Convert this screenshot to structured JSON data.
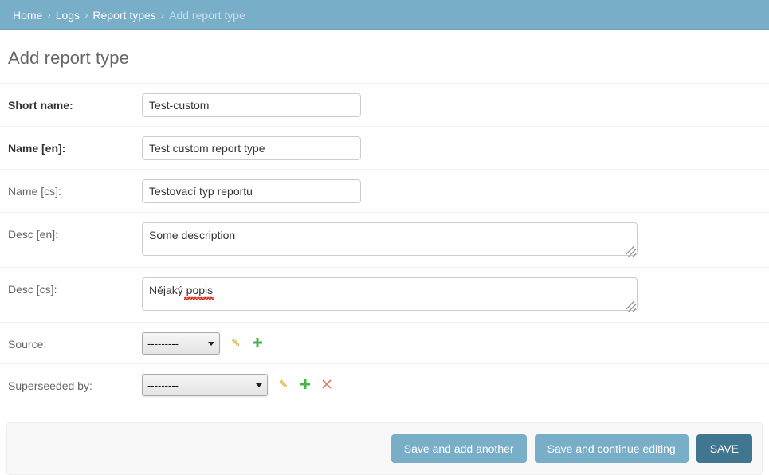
{
  "breadcrumbs": {
    "separator": "›",
    "items": [
      {
        "label": "Home",
        "current": false
      },
      {
        "label": "Logs",
        "current": false
      },
      {
        "label": "Report types",
        "current": false
      },
      {
        "label": "Add report type",
        "current": true
      }
    ]
  },
  "page": {
    "title": "Add report type"
  },
  "form": {
    "rows": [
      {
        "label": "Short name:",
        "required": true,
        "type": "text",
        "value": "Test-custom",
        "placeholder": ""
      },
      {
        "label": "Name [en]:",
        "required": true,
        "type": "text",
        "value": "Test custom report type",
        "placeholder": ""
      },
      {
        "label": "Name [cs]:",
        "required": false,
        "type": "text",
        "value": "Testovací typ reportu",
        "placeholder": ""
      },
      {
        "label": "Desc [en]:",
        "required": false,
        "type": "textarea",
        "value": "Some description",
        "placeholder": "",
        "spellcheck_error": false
      },
      {
        "label": "Desc [cs]:",
        "required": false,
        "type": "textarea",
        "value": "Nějaký popis",
        "placeholder": "",
        "spellcheck_error": true,
        "spellcheck_word": "popis"
      },
      {
        "label": "Source:",
        "required": false,
        "type": "select",
        "selected": "---------",
        "options": [
          "---------"
        ],
        "icons": [
          "pencil-icon",
          "plus-icon"
        ]
      },
      {
        "label": "Superseeded by:",
        "required": false,
        "type": "select",
        "selected": "---------",
        "options": [
          "---------"
        ],
        "icons": [
          "pencil-icon",
          "plus-icon",
          "delete-icon"
        ]
      }
    ]
  },
  "submit_row": {
    "save_and_add_another": "Save and add another",
    "save_and_continue": "Save and continue editing",
    "save": "SAVE"
  },
  "colors": {
    "breadcrumb_bg": "#79aec8",
    "button_default": "#79aec8",
    "button_primary": "#417690",
    "title_text": "#666666",
    "label_text": "#666666",
    "divider": "#eeeeee",
    "submit_row_bg": "#f8f8f8",
    "pencil_icon": "#efd36a",
    "plus_icon": "#44b549",
    "delete_icon": "#e8736a",
    "spellcheck_underline": "#d93025"
  }
}
